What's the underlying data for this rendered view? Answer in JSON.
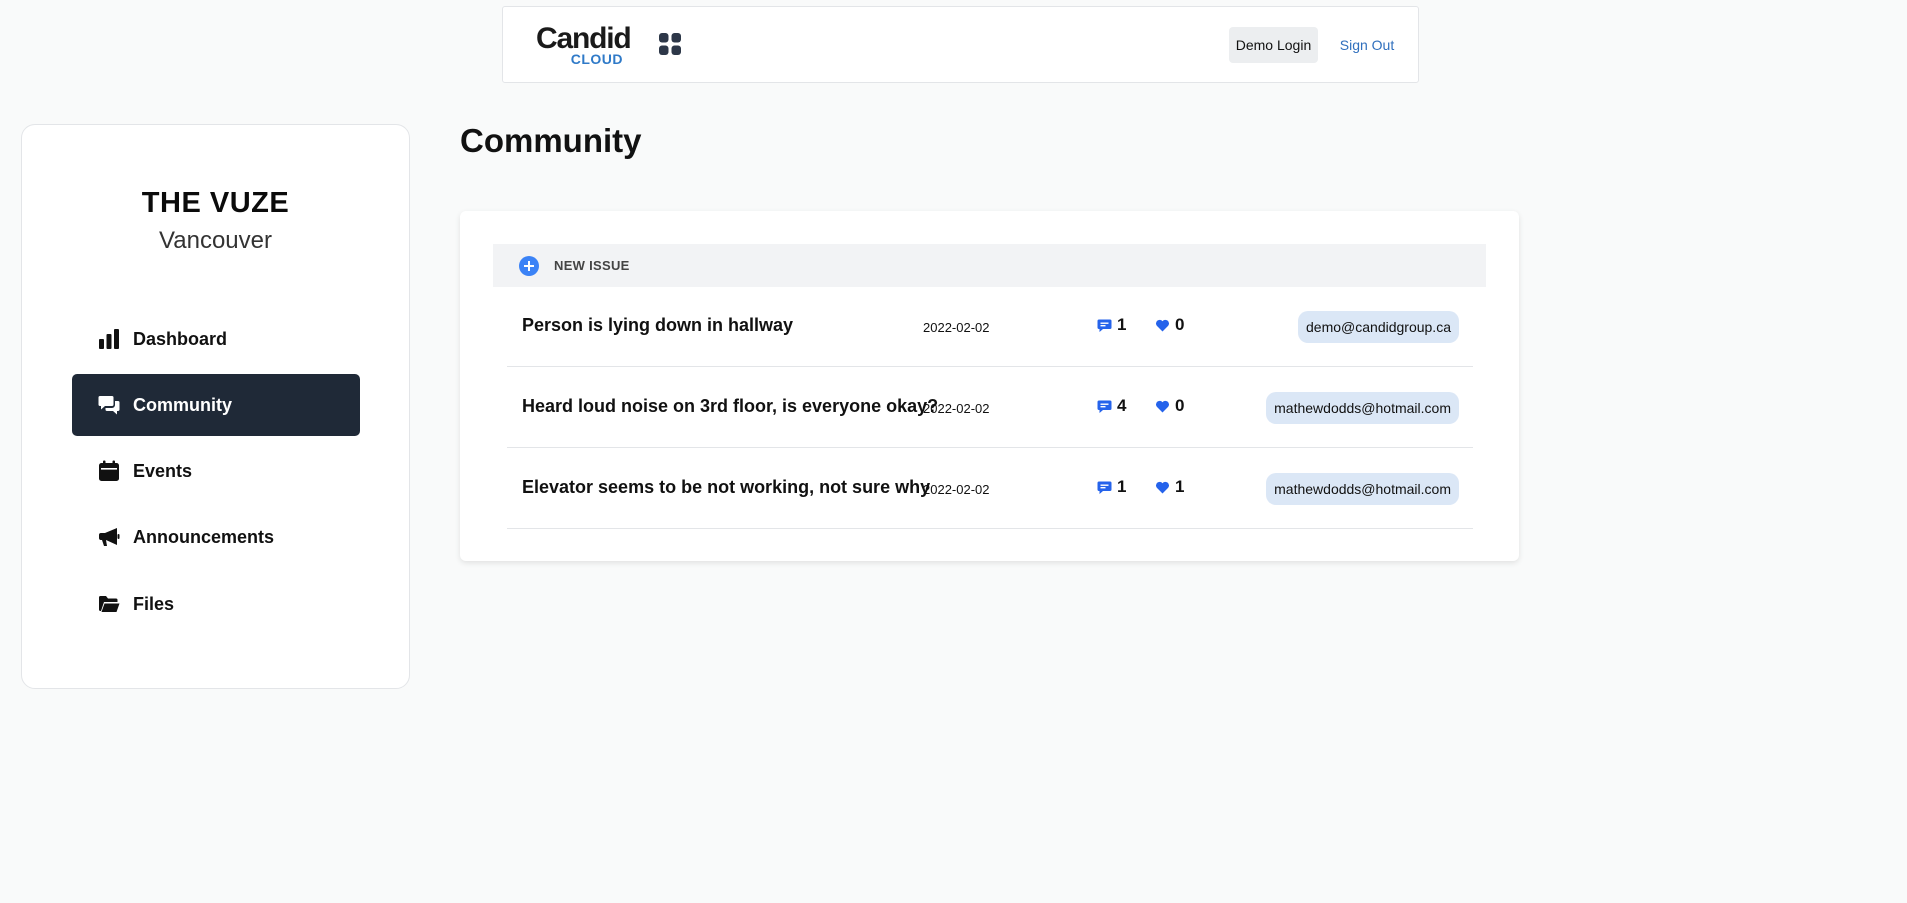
{
  "header": {
    "logo_main": "Candid",
    "logo_sub": "CLOUD",
    "demo_login_label": "Demo Login",
    "sign_out_label": "Sign Out",
    "apps_icon": "grid-icon"
  },
  "sidebar": {
    "building_name": "THE VUZE",
    "building_city": "Vancouver",
    "items": [
      {
        "label": "Dashboard",
        "icon": "bar-chart-icon",
        "active": false
      },
      {
        "label": "Community",
        "icon": "chat-bubbles-icon",
        "active": true
      },
      {
        "label": "Events",
        "icon": "calendar-icon",
        "active": false
      },
      {
        "label": "Announcements",
        "icon": "megaphone-icon",
        "active": false
      },
      {
        "label": "Files",
        "icon": "folder-icon",
        "active": false
      }
    ]
  },
  "main": {
    "title": "Community",
    "new_issue_label": "NEW ISSUE",
    "issues": [
      {
        "title": "Person is lying down in hallway",
        "date": "2022-02-02",
        "comments": "1",
        "likes": "0",
        "author": "demo@candidgroup.ca"
      },
      {
        "title": "Heard loud noise on 3rd floor, is everyone okay?",
        "date": "2022-02-02",
        "comments": "4",
        "likes": "0",
        "author": "mathewdodds@hotmail.com"
      },
      {
        "title": "Elevator seems to be not working, not sure why",
        "date": "2022-02-02",
        "comments": "1",
        "likes": "1",
        "author": "mathewdodds@hotmail.com"
      }
    ]
  },
  "colors": {
    "accent": "#3b82f6",
    "active_nav_bg": "#1f2937",
    "badge_bg": "#dbe7f6",
    "link": "#2f6fbd"
  }
}
